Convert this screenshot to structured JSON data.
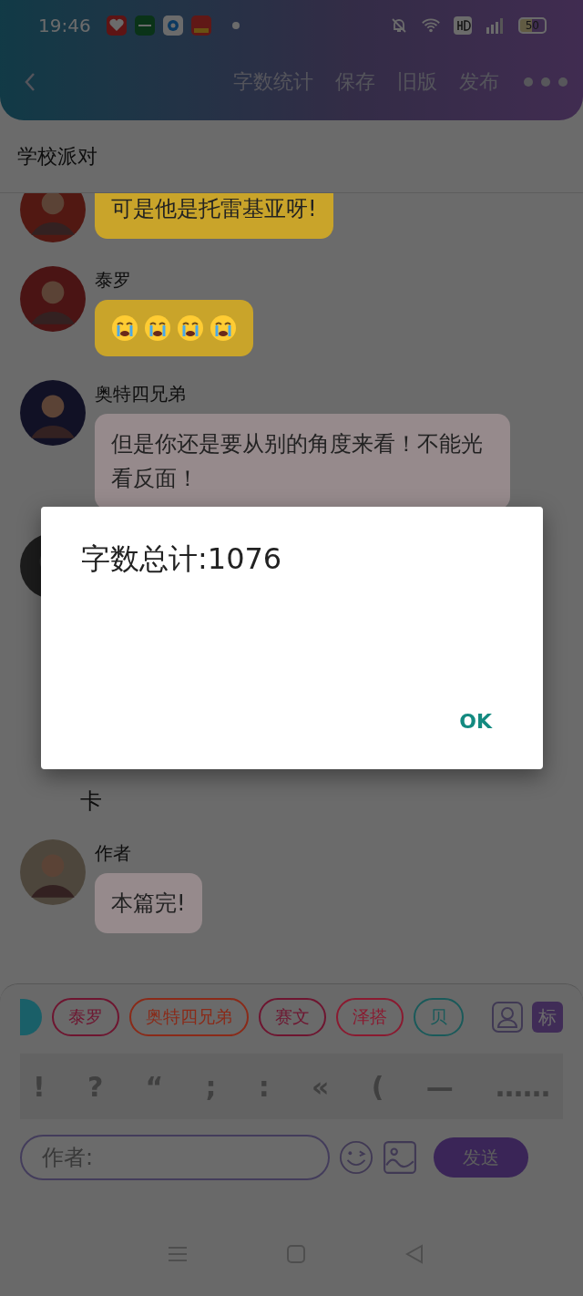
{
  "status_bar": {
    "time": "19:46",
    "battery": "50"
  },
  "header": {
    "actions": [
      "字数统计",
      "保存",
      "旧版",
      "发布"
    ]
  },
  "title": "学校派对",
  "messages": [
    {
      "kind": "bubble",
      "text": "可是他是托雷基亚呀!",
      "color": "#c9a42a"
    },
    {
      "kind": "emoji",
      "speaker": "泰罗",
      "emojis": [
        {
          "kind": "crying"
        },
        {
          "kind": "crying"
        },
        {
          "kind": "crying"
        },
        {
          "kind": "crying"
        }
      ],
      "color": "#c9a42a"
    },
    {
      "kind": "bubble",
      "speaker": "奥特四兄弟",
      "text": "但是你还是要从别的角度来看！不能光看反面！",
      "color": "#968a8c"
    },
    {
      "kind": "avatar_only"
    },
    {
      "kind": "narration",
      "text": "卡"
    },
    {
      "kind": "bubble",
      "speaker": "作者",
      "text": "本篇完!",
      "color": "#968a8c"
    }
  ],
  "tags": [
    {
      "label": "泰罗",
      "color": "#6e1530"
    },
    {
      "label": "奥特四兄弟",
      "color": "#8a2a18"
    },
    {
      "label": "赛文",
      "color": "#6e1530"
    },
    {
      "label": "泽搭",
      "color": "#8a1a30"
    },
    {
      "label": "贝",
      "color": "#1a5a5a"
    }
  ],
  "role_button": "标",
  "punctuation": [
    "!",
    "?",
    "“",
    ";",
    ":",
    "«",
    "(",
    "—",
    "……"
  ],
  "input": {
    "placeholder": "作者:"
  },
  "send_button": "发送",
  "dialog": {
    "message": "字数总计:1076",
    "button": "OK"
  }
}
